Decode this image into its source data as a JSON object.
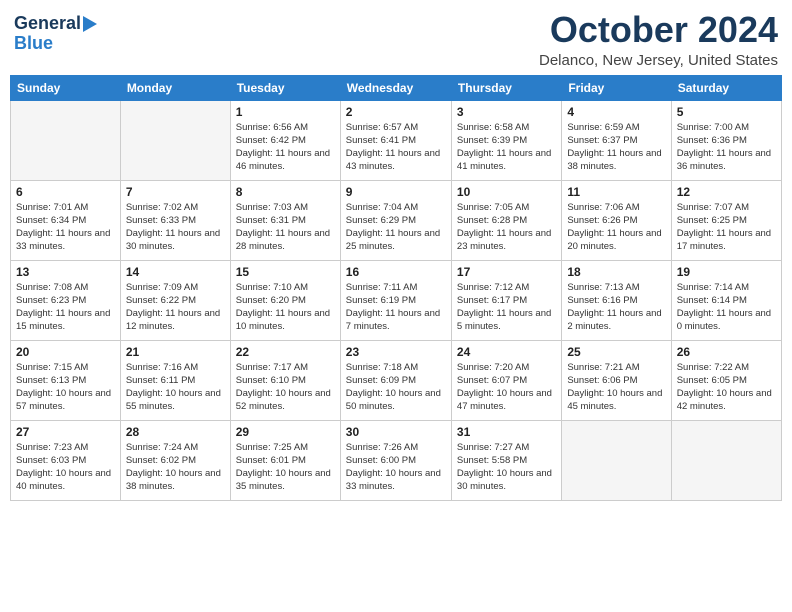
{
  "logo": {
    "line1": "General",
    "line2": "Blue"
  },
  "header": {
    "month": "October 2024",
    "location": "Delanco, New Jersey, United States"
  },
  "weekdays": [
    "Sunday",
    "Monday",
    "Tuesday",
    "Wednesday",
    "Thursday",
    "Friday",
    "Saturday"
  ],
  "weeks": [
    [
      {
        "day": "",
        "detail": ""
      },
      {
        "day": "",
        "detail": ""
      },
      {
        "day": "1",
        "detail": "Sunrise: 6:56 AM\nSunset: 6:42 PM\nDaylight: 11 hours and 46 minutes."
      },
      {
        "day": "2",
        "detail": "Sunrise: 6:57 AM\nSunset: 6:41 PM\nDaylight: 11 hours and 43 minutes."
      },
      {
        "day": "3",
        "detail": "Sunrise: 6:58 AM\nSunset: 6:39 PM\nDaylight: 11 hours and 41 minutes."
      },
      {
        "day": "4",
        "detail": "Sunrise: 6:59 AM\nSunset: 6:37 PM\nDaylight: 11 hours and 38 minutes."
      },
      {
        "day": "5",
        "detail": "Sunrise: 7:00 AM\nSunset: 6:36 PM\nDaylight: 11 hours and 36 minutes."
      }
    ],
    [
      {
        "day": "6",
        "detail": "Sunrise: 7:01 AM\nSunset: 6:34 PM\nDaylight: 11 hours and 33 minutes."
      },
      {
        "day": "7",
        "detail": "Sunrise: 7:02 AM\nSunset: 6:33 PM\nDaylight: 11 hours and 30 minutes."
      },
      {
        "day": "8",
        "detail": "Sunrise: 7:03 AM\nSunset: 6:31 PM\nDaylight: 11 hours and 28 minutes."
      },
      {
        "day": "9",
        "detail": "Sunrise: 7:04 AM\nSunset: 6:29 PM\nDaylight: 11 hours and 25 minutes."
      },
      {
        "day": "10",
        "detail": "Sunrise: 7:05 AM\nSunset: 6:28 PM\nDaylight: 11 hours and 23 minutes."
      },
      {
        "day": "11",
        "detail": "Sunrise: 7:06 AM\nSunset: 6:26 PM\nDaylight: 11 hours and 20 minutes."
      },
      {
        "day": "12",
        "detail": "Sunrise: 7:07 AM\nSunset: 6:25 PM\nDaylight: 11 hours and 17 minutes."
      }
    ],
    [
      {
        "day": "13",
        "detail": "Sunrise: 7:08 AM\nSunset: 6:23 PM\nDaylight: 11 hours and 15 minutes."
      },
      {
        "day": "14",
        "detail": "Sunrise: 7:09 AM\nSunset: 6:22 PM\nDaylight: 11 hours and 12 minutes."
      },
      {
        "day": "15",
        "detail": "Sunrise: 7:10 AM\nSunset: 6:20 PM\nDaylight: 11 hours and 10 minutes."
      },
      {
        "day": "16",
        "detail": "Sunrise: 7:11 AM\nSunset: 6:19 PM\nDaylight: 11 hours and 7 minutes."
      },
      {
        "day": "17",
        "detail": "Sunrise: 7:12 AM\nSunset: 6:17 PM\nDaylight: 11 hours and 5 minutes."
      },
      {
        "day": "18",
        "detail": "Sunrise: 7:13 AM\nSunset: 6:16 PM\nDaylight: 11 hours and 2 minutes."
      },
      {
        "day": "19",
        "detail": "Sunrise: 7:14 AM\nSunset: 6:14 PM\nDaylight: 11 hours and 0 minutes."
      }
    ],
    [
      {
        "day": "20",
        "detail": "Sunrise: 7:15 AM\nSunset: 6:13 PM\nDaylight: 10 hours and 57 minutes."
      },
      {
        "day": "21",
        "detail": "Sunrise: 7:16 AM\nSunset: 6:11 PM\nDaylight: 10 hours and 55 minutes."
      },
      {
        "day": "22",
        "detail": "Sunrise: 7:17 AM\nSunset: 6:10 PM\nDaylight: 10 hours and 52 minutes."
      },
      {
        "day": "23",
        "detail": "Sunrise: 7:18 AM\nSunset: 6:09 PM\nDaylight: 10 hours and 50 minutes."
      },
      {
        "day": "24",
        "detail": "Sunrise: 7:20 AM\nSunset: 6:07 PM\nDaylight: 10 hours and 47 minutes."
      },
      {
        "day": "25",
        "detail": "Sunrise: 7:21 AM\nSunset: 6:06 PM\nDaylight: 10 hours and 45 minutes."
      },
      {
        "day": "26",
        "detail": "Sunrise: 7:22 AM\nSunset: 6:05 PM\nDaylight: 10 hours and 42 minutes."
      }
    ],
    [
      {
        "day": "27",
        "detail": "Sunrise: 7:23 AM\nSunset: 6:03 PM\nDaylight: 10 hours and 40 minutes."
      },
      {
        "day": "28",
        "detail": "Sunrise: 7:24 AM\nSunset: 6:02 PM\nDaylight: 10 hours and 38 minutes."
      },
      {
        "day": "29",
        "detail": "Sunrise: 7:25 AM\nSunset: 6:01 PM\nDaylight: 10 hours and 35 minutes."
      },
      {
        "day": "30",
        "detail": "Sunrise: 7:26 AM\nSunset: 6:00 PM\nDaylight: 10 hours and 33 minutes."
      },
      {
        "day": "31",
        "detail": "Sunrise: 7:27 AM\nSunset: 5:58 PM\nDaylight: 10 hours and 30 minutes."
      },
      {
        "day": "",
        "detail": ""
      },
      {
        "day": "",
        "detail": ""
      }
    ]
  ]
}
